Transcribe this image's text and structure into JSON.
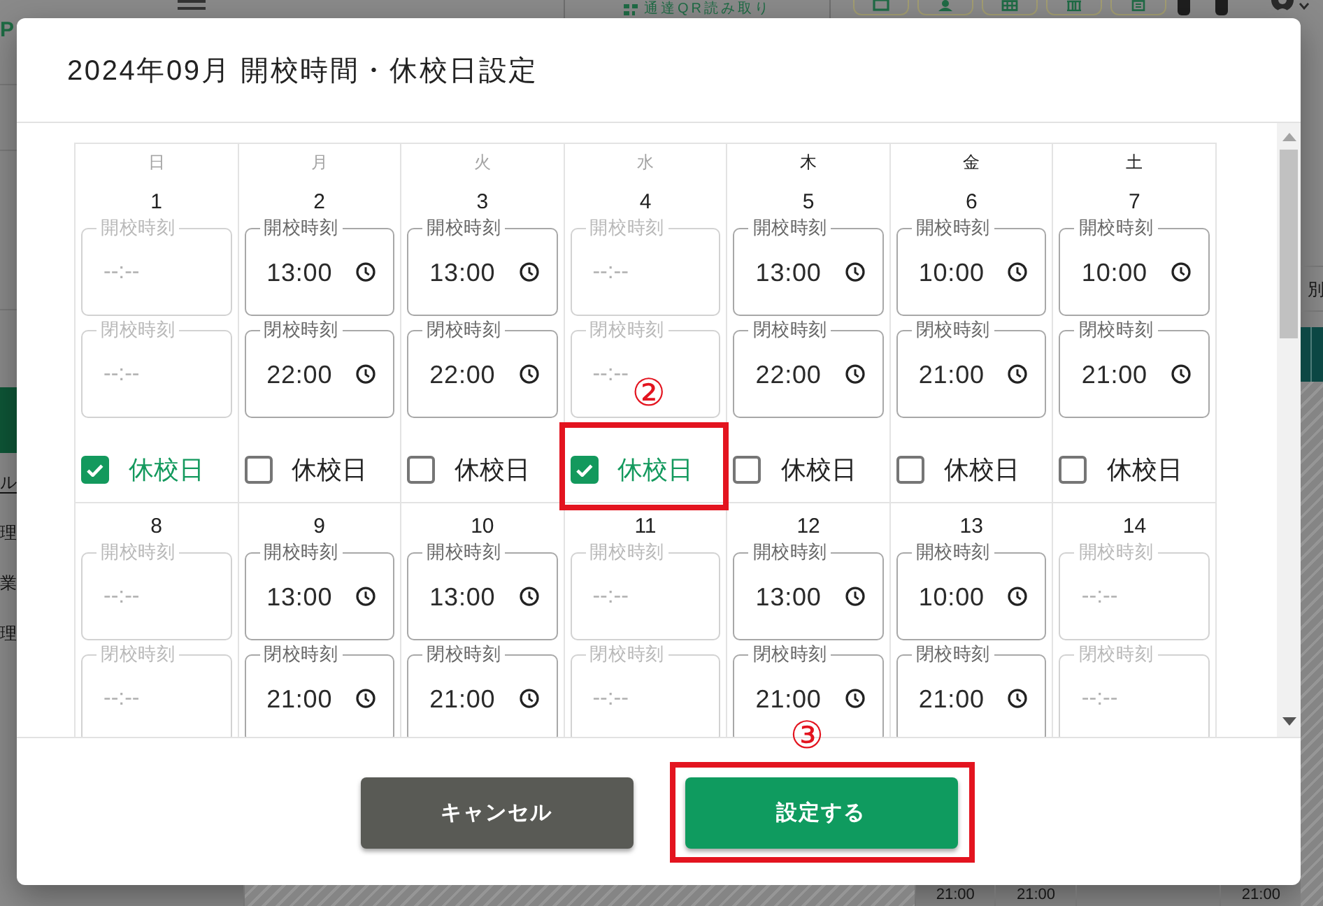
{
  "page": {
    "header": {
      "qr_button": "通達QR読み取り"
    },
    "logo": "P",
    "sidebar": [
      {
        "selected": true
      },
      {
        "label": "ル",
        "selected": false
      },
      {
        "label": "理",
        "selected": false
      },
      {
        "label": "業",
        "selected": false
      },
      {
        "label": "理",
        "selected": false
      }
    ],
    "table": {
      "column_header": "別",
      "bottom_cells": [
        "21:00",
        "21:00",
        "21:00"
      ]
    }
  },
  "dialog": {
    "title": "2024年09月 開校時間・休校日設定",
    "calendar": {
      "weekdays": [
        {
          "label": "日",
          "muted": true
        },
        {
          "label": "月",
          "muted": true
        },
        {
          "label": "火",
          "muted": true
        },
        {
          "label": "水",
          "muted": true
        },
        {
          "label": "木",
          "muted": false
        },
        {
          "label": "金",
          "muted": false
        },
        {
          "label": "土",
          "muted": false
        }
      ],
      "weeks": [
        {
          "days": [
            {
              "date": "1",
              "fields": [
                {
                  "label": "開校時刻",
                  "placeholder": "--:--",
                  "disabled": true
                },
                {
                  "label": "閉校時刻",
                  "placeholder": "--:--",
                  "disabled": true
                }
              ],
              "checkbox": {
                "label": "休校日",
                "checked": true
              }
            },
            {
              "date": "2",
              "fields": [
                {
                  "label": "開校時刻",
                  "value": "13:00",
                  "disabled": false
                },
                {
                  "label": "閉校時刻",
                  "value": "22:00",
                  "disabled": false
                }
              ],
              "checkbox": {
                "label": "休校日",
                "checked": false
              }
            },
            {
              "date": "3",
              "fields": [
                {
                  "label": "開校時刻",
                  "value": "13:00",
                  "disabled": false
                },
                {
                  "label": "閉校時刻",
                  "value": "22:00",
                  "disabled": false
                }
              ],
              "checkbox": {
                "label": "休校日",
                "checked": false
              }
            },
            {
              "date": "4",
              "fields": [
                {
                  "label": "開校時刻",
                  "placeholder": "--:--",
                  "disabled": true
                },
                {
                  "label": "閉校時刻",
                  "placeholder": "--:--",
                  "disabled": true
                }
              ],
              "checkbox": {
                "label": "休校日",
                "checked": true
              },
              "callout": "②"
            },
            {
              "date": "5",
              "fields": [
                {
                  "label": "開校時刻",
                  "value": "13:00",
                  "disabled": false
                },
                {
                  "label": "閉校時刻",
                  "value": "22:00",
                  "disabled": false
                }
              ],
              "checkbox": {
                "label": "休校日",
                "checked": false
              }
            },
            {
              "date": "6",
              "fields": [
                {
                  "label": "開校時刻",
                  "value": "10:00",
                  "disabled": false
                },
                {
                  "label": "閉校時刻",
                  "value": "21:00",
                  "disabled": false
                }
              ],
              "checkbox": {
                "label": "休校日",
                "checked": false
              }
            },
            {
              "date": "7",
              "fields": [
                {
                  "label": "開校時刻",
                  "value": "10:00",
                  "disabled": false
                },
                {
                  "label": "閉校時刻",
                  "value": "21:00",
                  "disabled": false
                }
              ],
              "checkbox": {
                "label": "休校日",
                "checked": false
              }
            }
          ]
        },
        {
          "days": [
            {
              "date": "8",
              "fields": [
                {
                  "label": "開校時刻",
                  "placeholder": "--:--",
                  "disabled": true
                },
                {
                  "label": "閉校時刻",
                  "placeholder": "--:--",
                  "disabled": true
                }
              ]
            },
            {
              "date": "9",
              "fields": [
                {
                  "label": "開校時刻",
                  "value": "13:00",
                  "disabled": false
                },
                {
                  "label": "閉校時刻",
                  "value": "21:00",
                  "disabled": false
                }
              ]
            },
            {
              "date": "10",
              "fields": [
                {
                  "label": "開校時刻",
                  "value": "13:00",
                  "disabled": false
                },
                {
                  "label": "閉校時刻",
                  "value": "21:00",
                  "disabled": false
                }
              ]
            },
            {
              "date": "11",
              "fields": [
                {
                  "label": "開校時刻",
                  "placeholder": "--:--",
                  "disabled": true
                },
                {
                  "label": "閉校時刻",
                  "placeholder": "--:--",
                  "disabled": true
                }
              ]
            },
            {
              "date": "12",
              "fields": [
                {
                  "label": "開校時刻",
                  "value": "13:00",
                  "disabled": false
                },
                {
                  "label": "閉校時刻",
                  "value": "21:00",
                  "disabled": false
                }
              ]
            },
            {
              "date": "13",
              "fields": [
                {
                  "label": "開校時刻",
                  "value": "10:00",
                  "disabled": false
                },
                {
                  "label": "閉校時刻",
                  "value": "21:00",
                  "disabled": false
                }
              ]
            },
            {
              "date": "14",
              "fields": [
                {
                  "label": "開校時刻",
                  "placeholder": "--:--",
                  "disabled": true
                },
                {
                  "label": "閉校時刻",
                  "placeholder": "--:--",
                  "disabled": true
                }
              ]
            }
          ]
        }
      ]
    },
    "buttons": [
      {
        "label": "キャンセル",
        "kind": "cancel"
      },
      {
        "label": "設定する",
        "kind": "confirm",
        "callout": "③"
      }
    ]
  }
}
